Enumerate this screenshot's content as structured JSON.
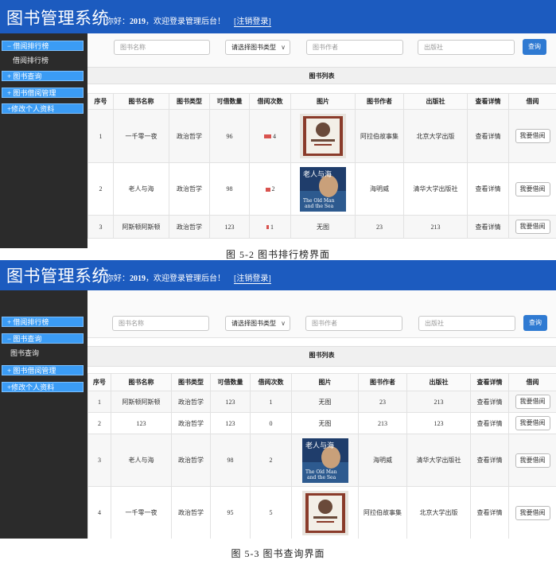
{
  "app": {
    "title": "图书管理系统",
    "greeting_prefix": "你好：",
    "username": "2019",
    "greeting_suffix": "，欢迎登录管理后台！",
    "logout": "[注销登录]"
  },
  "sidebar": {
    "rank": "− 借阅排行榜",
    "rank_closed": "+ 借阅排行榜",
    "rank_sub": "借阅排行榜",
    "query": "+ 图书查询",
    "query_open": "− 图书查询",
    "query_sub": "图书查询",
    "manage": "+ 图书借阅管理",
    "profile": "+修改个人资料"
  },
  "search": {
    "name_placeholder": "图书名称",
    "type_selected": "请选择图书类型",
    "author_placeholder": "图书作者",
    "publisher_placeholder": "出版社",
    "query_button": "查询"
  },
  "list_title": "图书列表",
  "columns": [
    "序号",
    "图书名称",
    "图书类型",
    "可借数量",
    "借阅次数",
    "图片",
    "图书作者",
    "出版社",
    "查看详情",
    "借阅"
  ],
  "table1": [
    {
      "no": "1",
      "name": "一千零一夜",
      "type": "政治哲学",
      "qty": "96",
      "count": "4",
      "pic": "",
      "author": "阿拉伯故事集",
      "pub": "北京大学出版",
      "detail": "查看详情",
      "borrow": "我要借阅"
    },
    {
      "no": "2",
      "name": "老人与海",
      "type": "政治哲学",
      "qty": "98",
      "count": "2",
      "pic": "",
      "author": "海明威",
      "pub": "清华大学出版社",
      "detail": "查看详情",
      "borrow": "我要借阅"
    },
    {
      "no": "3",
      "name": "阿斯顿阿斯顿",
      "type": "政治哲学",
      "qty": "123",
      "count": "1",
      "pic": "无图",
      "author": "23",
      "pub": "213",
      "detail": "查看详情",
      "borrow": "我要借阅"
    }
  ],
  "table2": [
    {
      "no": "1",
      "name": "阿斯顿阿斯顿",
      "type": "政治哲学",
      "qty": "123",
      "count": "1",
      "pic": "无图",
      "author": "23",
      "pub": "213",
      "detail": "查看详情",
      "borrow": "我要借阅"
    },
    {
      "no": "2",
      "name": "123",
      "type": "政治哲学",
      "qty": "123",
      "count": "0",
      "pic": "无图",
      "author": "213",
      "pub": "123",
      "detail": "查看详情",
      "borrow": "我要借阅"
    },
    {
      "no": "3",
      "name": "老人与海",
      "type": "政治哲学",
      "qty": "98",
      "count": "2",
      "pic": "",
      "author": "海明威",
      "pub": "清华大学出版社",
      "detail": "查看详情",
      "borrow": "我要借阅"
    },
    {
      "no": "4",
      "name": "一千零一夜",
      "type": "政治哲学",
      "qty": "95",
      "count": "5",
      "pic": "",
      "author": "阿拉伯故事集",
      "pub": "北京大学出版",
      "detail": "查看详情",
      "borrow": "我要借阅"
    }
  ],
  "cover_texts": {
    "oldman_cn": "老人与海",
    "oldman_en1": "The Old Man",
    "oldman_en2": "and the Sea"
  },
  "captions": {
    "fig1": "图 5-2  图书排行榜界面",
    "fig2": "图 5-3  图书查询界面"
  },
  "colors": {
    "header": "#1c5bbf",
    "sidebar": "#2b2b2b",
    "menu": "#3b9cf5",
    "button": "#2f7ad2",
    "bar": "#d9534f"
  }
}
